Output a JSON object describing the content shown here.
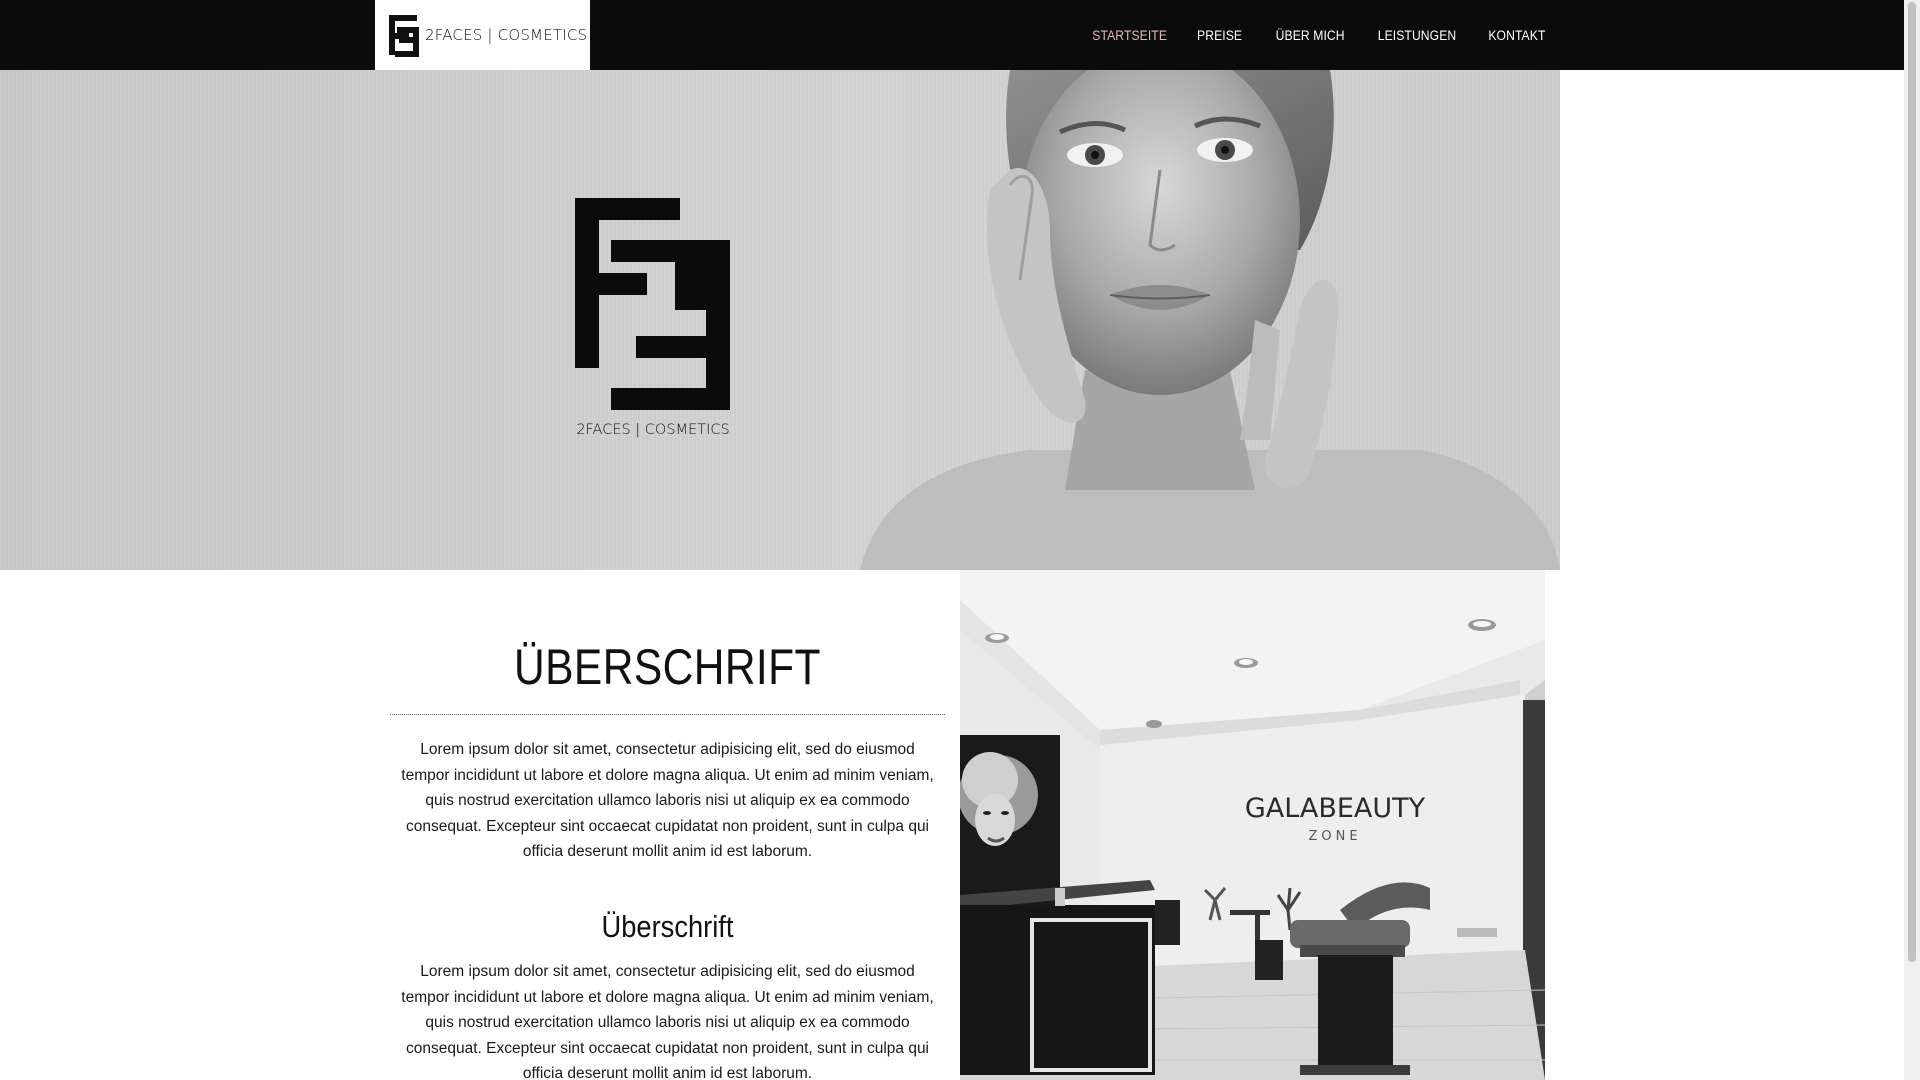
{
  "header": {
    "logo_text": "2FACES | COSMETICS",
    "nav": [
      {
        "label": "STARTSEITE",
        "active": true
      },
      {
        "label": "PREISE",
        "active": false
      },
      {
        "label": "ÜBER MICH",
        "active": false
      },
      {
        "label": "LEISTUNGEN",
        "active": false
      },
      {
        "label": "KONTAKT",
        "active": false
      }
    ],
    "active_color": "#e3b8b2"
  },
  "hero": {
    "logo_text": "2FACES | COSMETICS"
  },
  "main": {
    "heading": "ÜBERSCHRIFT",
    "paragraph1": "Lorem ipsum dolor sit amet, consectetur adipisicing elit, sed do eiusmod tempor incididunt ut labore et dolore magna aliqua. Ut enim ad minim veniam, quis nostrud exercitation ullamco laboris nisi ut aliquip ex ea commodo consequat. Excepteur sint occaecat cupidatat non proident, sunt in culpa qui officia deserunt mollit anim id est laborum.",
    "subheading": "Überschrift",
    "paragraph2": "Lorem ipsum dolor sit amet, consectetur adipisicing elit, sed do eiusmod tempor incididunt ut labore et dolore magna aliqua. Ut enim ad minim veniam, quis nostrud exercitation ullamco laboris nisi ut aliquip ex ea commodo consequat. Excepteur sint occaecat cupidatat non proident, sunt in culpa qui officia deserunt mollit anim id est laborum."
  },
  "salon": {
    "wall_sign": "GALABEAUTY",
    "wall_sign_sub": "ZONE"
  }
}
